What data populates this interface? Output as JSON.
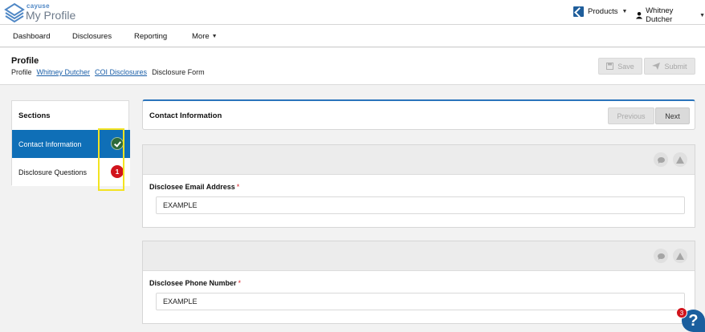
{
  "header": {
    "brand_small": "cayuse",
    "brand_title": "My Profile",
    "products_label": "Products",
    "user_name": "Whitney Dutcher"
  },
  "nav": {
    "items": [
      {
        "label": "Dashboard"
      },
      {
        "label": "Disclosures"
      },
      {
        "label": "Reporting"
      },
      {
        "label": "More"
      }
    ]
  },
  "page": {
    "title": "Profile",
    "breadcrumb": [
      "Profile",
      "Whitney Dutcher",
      "COI Disclosures",
      "Disclosure Form"
    ],
    "save_label": "Save",
    "submit_label": "Submit"
  },
  "sections": {
    "title": "Sections",
    "items": [
      {
        "label": "Contact Information",
        "status": "complete"
      },
      {
        "label": "Disclosure Questions",
        "status": "errors",
        "count": "1"
      }
    ]
  },
  "form": {
    "section_title": "Contact Information",
    "previous_label": "Previous",
    "next_label": "Next",
    "questions": [
      {
        "label": "Disclosee Email Address",
        "required": "*",
        "value": "EXAMPLE"
      },
      {
        "label": "Disclosee Phone Number",
        "required": "*",
        "value": "EXAMPLE"
      }
    ]
  },
  "help": {
    "icon_text": "?",
    "count": "3"
  },
  "colors": {
    "active_section": "#0f6fb7",
    "complete_badge": "#2d6a3a",
    "error_badge": "#d1141c",
    "highlight": "#f3e321",
    "link": "#1b5fa8"
  }
}
